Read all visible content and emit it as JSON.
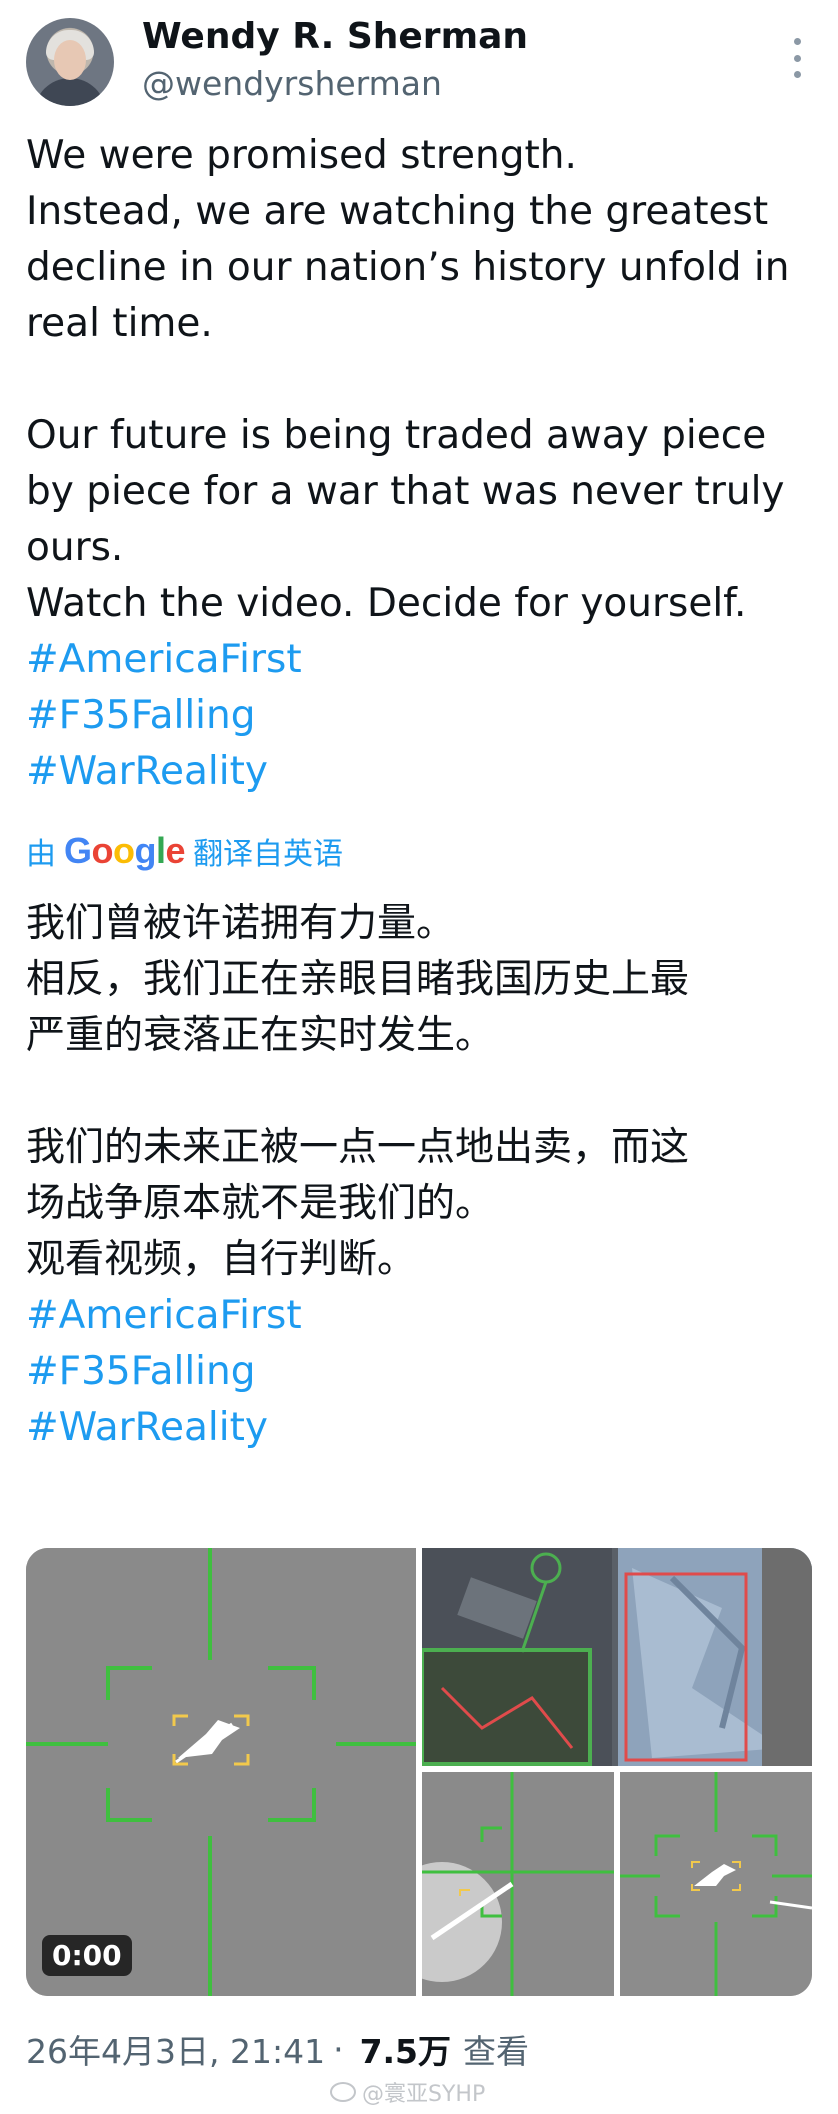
{
  "author": {
    "name": "Wendy R. Sherman",
    "handle": "@wendyrsherman"
  },
  "post": {
    "english_lines": [
      "We were promised strength.",
      "Instead, we are watching the greatest",
      "decline in our nation’s history unfold in",
      "real time.",
      "",
      "Our future is being traded away piece",
      "by piece for a war that was never truly",
      "ours.",
      "Watch the video. Decide for yourself."
    ],
    "hashtags": [
      "#AmericaFirst",
      "#F35Falling",
      "#WarReality"
    ],
    "translation_prefix": "由",
    "translation_brand": "Google",
    "translation_suffix": "翻译自英语",
    "chinese_lines": [
      "我们曾被许诺拥有力量。",
      "相反，我们正在亲眼目睹我国历史上最",
      "严重的衰落正在实时发生。",
      "",
      "我们的未来正被一点一点地出卖，而这",
      "场战争原本就不是我们的。",
      "观看视频，自行判断。"
    ],
    "chinese_hashtags": [
      "#AmericaFirst",
      "#F35Falling",
      "#WarReality"
    ]
  },
  "media": {
    "video_duration": "0:00"
  },
  "meta": {
    "timestamp": "26年4月3日, 21:41",
    "separator": "·",
    "views_count": "7.5万",
    "views_label": "查看"
  },
  "watermark": {
    "text": "@寰亚SYHP"
  },
  "colors": {
    "link": "#1d9bf0",
    "text": "#0f1419",
    "muted": "#536471",
    "reticle": "#3fbf3f",
    "target_box": "#f2c94c"
  },
  "icons": [
    "more-vertical-icon",
    "google-logo",
    "weibo-icon"
  ]
}
